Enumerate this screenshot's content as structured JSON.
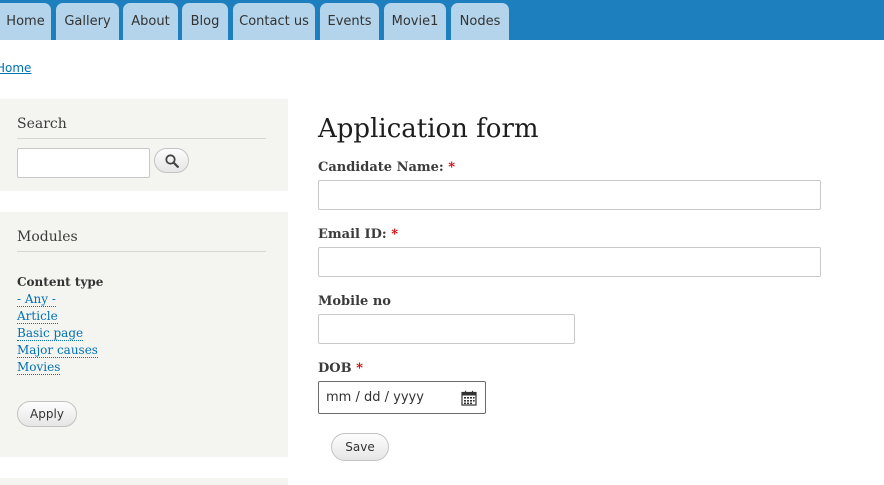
{
  "nav": {
    "tabs": [
      {
        "label": "Home"
      },
      {
        "label": "Gallery"
      },
      {
        "label": "About"
      },
      {
        "label": "Blog"
      },
      {
        "label": "Contact us"
      },
      {
        "label": "Events"
      },
      {
        "label": "Movie1"
      },
      {
        "label": "Nodes"
      }
    ]
  },
  "breadcrumb": {
    "home": "Home"
  },
  "sidebar": {
    "search": {
      "title": "Search",
      "input_value": "",
      "button_icon": "search-icon"
    },
    "modules": {
      "title": "Modules",
      "facet_label": "Content type",
      "links": [
        {
          "label": "- Any -"
        },
        {
          "label": "Article"
        },
        {
          "label": "Basic page"
        },
        {
          "label": "Major causes"
        },
        {
          "label": "Movies"
        }
      ],
      "apply_label": "Apply"
    }
  },
  "form": {
    "title": "Application form",
    "required_marker": "*",
    "candidate_name": {
      "label": "Candidate Name:",
      "value": ""
    },
    "email": {
      "label": "Email ID:",
      "value": ""
    },
    "mobile": {
      "label": "Mobile no",
      "value": ""
    },
    "dob": {
      "label": "DOB",
      "placeholder": "mm / dd / yyyy"
    },
    "save_label": "Save"
  },
  "colors": {
    "nav_bar": "#1e7fbf",
    "tab_bg": "#b3d4ea",
    "link": "#0071b3",
    "required": "#d50000",
    "sidebar_bg": "#f4f4f0"
  }
}
